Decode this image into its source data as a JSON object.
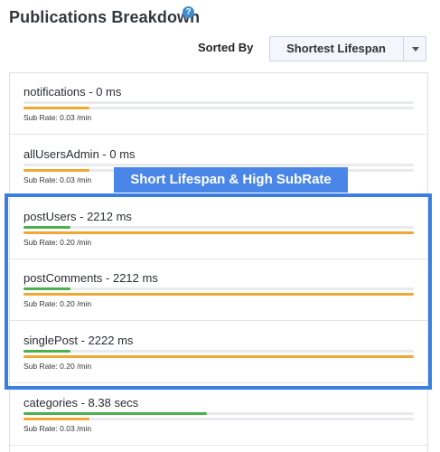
{
  "header": {
    "title": "Publications Breakdown",
    "help_icon": "?"
  },
  "sort": {
    "label": "Sorted By",
    "value": "Shortest Lifespan"
  },
  "highlight": {
    "label": "Short Lifespan & High SubRate"
  },
  "colors": {
    "lifespan_bar": "#4caf50",
    "subrate_bar": "#f0a833",
    "highlight": "#3a7fe0"
  },
  "publications": [
    {
      "name": "notifications - 0 ms",
      "sub_rate": "Sub Rate: 0.03 /min",
      "lifespan_fraction": 0.0,
      "subrate_fraction": 0.17
    },
    {
      "name": "allUsersAdmin - 0 ms",
      "sub_rate": "Sub Rate: 0.03 /min",
      "lifespan_fraction": 0.0,
      "subrate_fraction": 0.17
    },
    {
      "name": "postUsers - 2212 ms",
      "sub_rate": "Sub Rate: 0.20 /min",
      "lifespan_fraction": 0.12,
      "subrate_fraction": 1.0
    },
    {
      "name": "postComments - 2212 ms",
      "sub_rate": "Sub Rate: 0.20 /min",
      "lifespan_fraction": 0.12,
      "subrate_fraction": 1.0
    },
    {
      "name": "singlePost - 2222 ms",
      "sub_rate": "Sub Rate: 0.20 /min",
      "lifespan_fraction": 0.12,
      "subrate_fraction": 1.0
    },
    {
      "name": "categories - 8.38 secs",
      "sub_rate": "Sub Rate: 0.03 /min",
      "lifespan_fraction": 0.47,
      "subrate_fraction": 0.17
    }
  ]
}
